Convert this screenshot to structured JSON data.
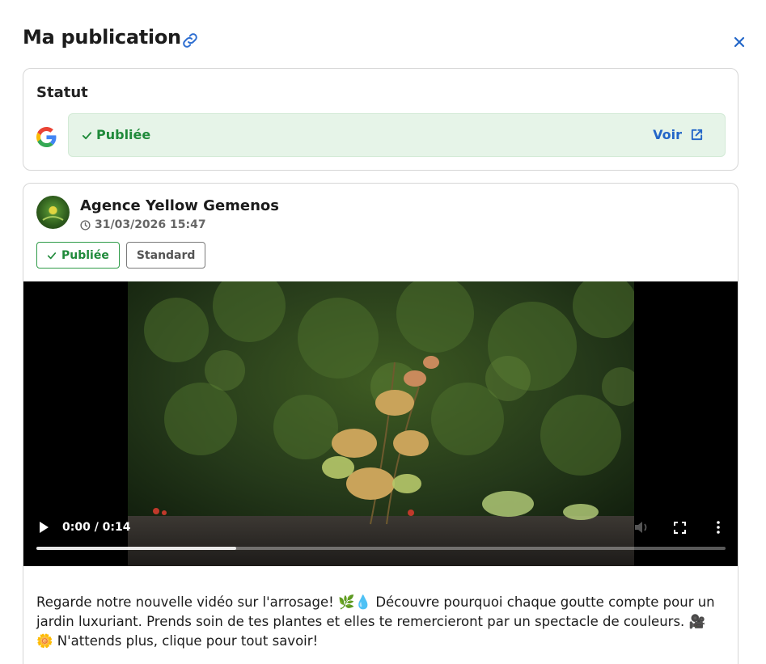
{
  "header": {
    "title": "Ma publication"
  },
  "status": {
    "heading": "Statut",
    "platform_icon": "google-icon",
    "state_label": "Publiée",
    "view_label": "Voir"
  },
  "post": {
    "author": "Agence Yellow Gemenos",
    "date": "31/03/2026 15:47",
    "badges": {
      "published": "Publiée",
      "type": "Standard"
    },
    "video": {
      "time": "0:00 / 0:14",
      "buffered_fraction": 0.29
    },
    "caption": "Regarde notre nouvelle vidéo sur l'arrosage! 🌿💧 Découvre pourquoi chaque goutte compte pour un jardin luxuriant. Prends soin de tes plantes et elles te remercieront par un spectacle de couleurs. 🎥🌼 N'attends plus, clique pour tout savoir!"
  },
  "colors": {
    "success_green": "#1f8a3a",
    "success_bg": "#e6f4e8",
    "link_blue": "#2366c8",
    "border": "#d6d6d6"
  }
}
